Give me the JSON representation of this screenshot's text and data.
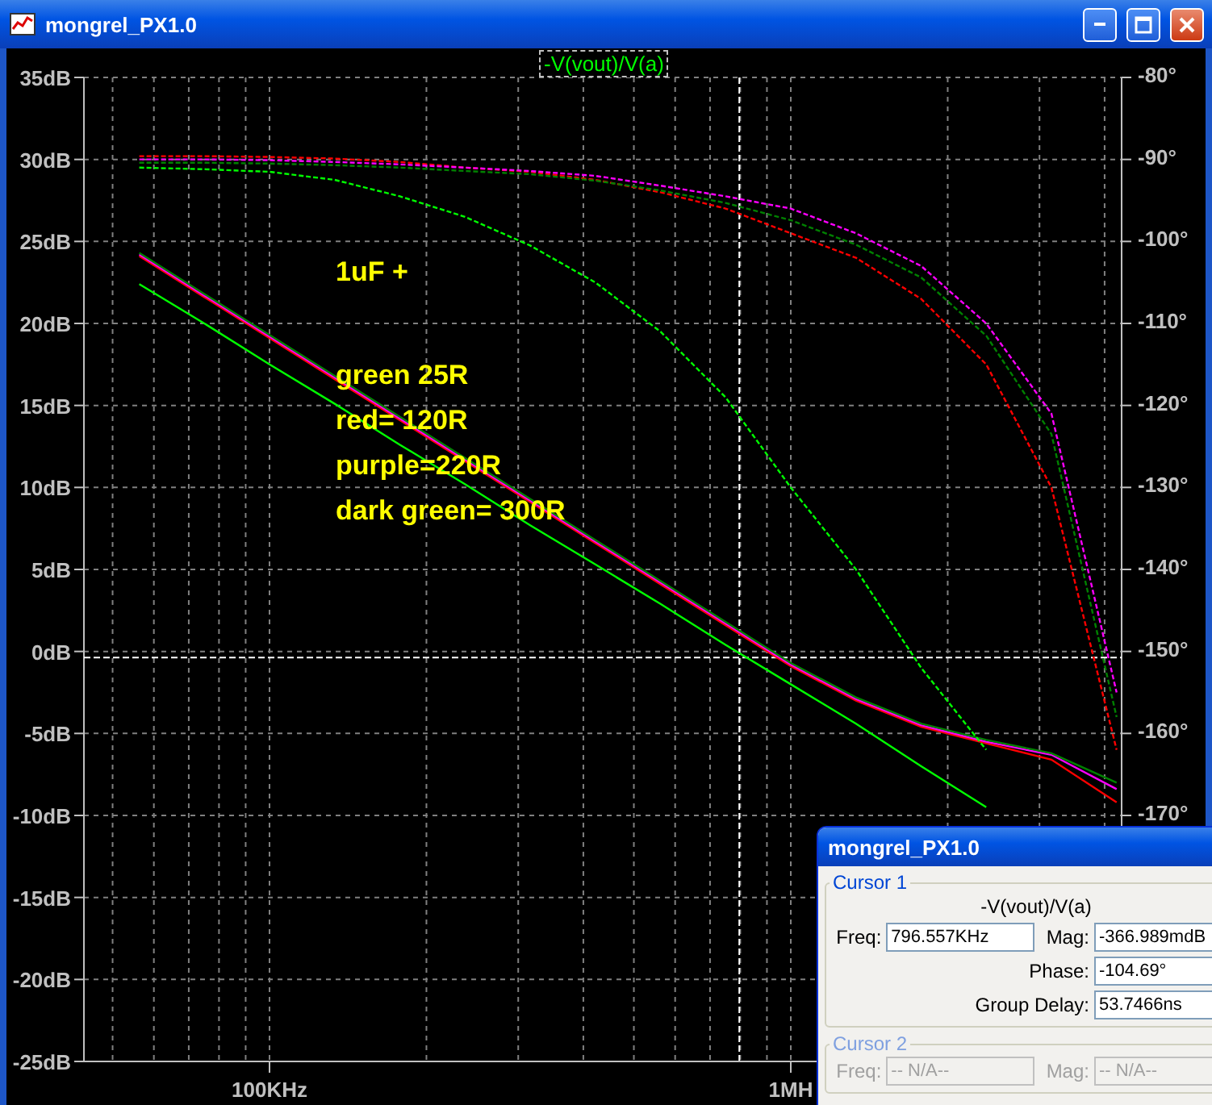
{
  "window": {
    "title": "mongrel_PX1.0"
  },
  "plot": {
    "chart_data": {
      "type": "line",
      "title": "-V(vout)/V(a)",
      "categories": [
        null,
        null,
        "100KHz",
        null,
        null,
        null,
        null,
        null,
        null,
        null,
        "1MH",
        null,
        null,
        null,
        null,
        null
      ],
      "ylim": [
        -25,
        35
      ],
      "y2lim": [
        -200,
        -80
      ],
      "grid": true,
      "yticks": [
        {
          "value": 35,
          "label": "35dB"
        },
        {
          "value": 30,
          "label": "30dB"
        },
        {
          "value": 25,
          "label": "25dB"
        },
        {
          "value": 20,
          "label": "20dB"
        },
        {
          "value": 15,
          "label": "15dB"
        },
        {
          "value": 10,
          "label": "10dB"
        },
        {
          "value": 5,
          "label": "5dB"
        },
        {
          "value": 0,
          "label": "0dB"
        },
        {
          "value": -5,
          "label": "-5dB"
        },
        {
          "value": -10,
          "label": "-10dB"
        },
        {
          "value": -15,
          "label": "-15dB"
        },
        {
          "value": -20,
          "label": "-20dB"
        },
        {
          "value": -25,
          "label": "-25dB"
        }
      ],
      "y2ticks": [
        {
          "value": -80,
          "label": "-80°"
        },
        {
          "value": -90,
          "label": "-90°"
        },
        {
          "value": -100,
          "label": "-100°"
        },
        {
          "value": -110,
          "label": "-110°"
        },
        {
          "value": -120,
          "label": "-120°"
        },
        {
          "value": -130,
          "label": "-130°"
        },
        {
          "value": -140,
          "label": "-140°"
        },
        {
          "value": -150,
          "label": "-150°"
        },
        {
          "value": -160,
          "label": "-160°"
        },
        {
          "value": -170,
          "label": "-170°"
        }
      ],
      "series": [
        {
          "color": "#00ff00",
          "values": [
            22.4,
            20.0,
            17.5,
            15.1,
            12.6,
            10.2,
            7.7,
            5.3,
            2.9,
            0.4,
            -2.0,
            -4.4,
            -7.0,
            -9.5,
            null,
            null
          ]
        },
        {
          "color": "#ff0000",
          "values": [
            24.1,
            21.6,
            19.1,
            16.6,
            14.1,
            11.6,
            9.1,
            6.6,
            4.1,
            1.6,
            -0.9,
            -3.0,
            -4.6,
            -5.6,
            -6.6,
            -9.2
          ]
        },
        {
          "color": "#ff00ff",
          "values": [
            24.2,
            21.7,
            19.2,
            16.7,
            14.2,
            11.7,
            9.2,
            6.7,
            4.2,
            1.7,
            -0.8,
            -2.9,
            -4.5,
            -5.5,
            -6.3,
            -8.4
          ]
        },
        {
          "color": "#008000",
          "values": [
            24.3,
            21.8,
            19.3,
            16.8,
            14.3,
            11.8,
            9.3,
            6.8,
            4.3,
            1.8,
            -0.7,
            -2.8,
            -4.4,
            -5.4,
            -6.2,
            -8.0
          ]
        },
        {
          "color": "#00ff00",
          "axis": "y2",
          "line_style": "dashed",
          "values": [
            -91.0,
            -91.2,
            -91.5,
            -92.5,
            -94.5,
            -97,
            -100.5,
            -105,
            -111,
            -119,
            -130,
            -140,
            -152,
            -162,
            null,
            null
          ]
        },
        {
          "color": "#ff0000",
          "axis": "y2",
          "line_style": "dashed",
          "values": [
            -89.6,
            -89.6,
            -89.7,
            -89.9,
            -90.3,
            -91,
            -91.5,
            -92.5,
            -94,
            -96,
            -99,
            -102,
            -107,
            -115,
            -130,
            -162
          ]
        },
        {
          "color": "#ff00ff",
          "axis": "y2",
          "line_style": "dashed",
          "values": [
            -90.0,
            -90.0,
            -90.1,
            -90.3,
            -90.6,
            -91.0,
            -91.4,
            -92,
            -93.2,
            -94.5,
            -96,
            -99,
            -103,
            -110,
            -121,
            -155
          ]
        },
        {
          "color": "#008000",
          "axis": "y2",
          "line_style": "dashed",
          "values": [
            -90.4,
            -90.4,
            -90.5,
            -90.7,
            -91.0,
            -91.4,
            -91.8,
            -92.6,
            -93.8,
            -95.3,
            -97.4,
            -100.4,
            -104.4,
            -111.5,
            -123.5,
            -158
          ]
        }
      ],
      "annotations": [
        "1uF +",
        "green 25R",
        "red= 120R",
        "purple=220R",
        "dark green= 300R"
      ],
      "ref_lines": [
        {
          "axis": "y",
          "value": -0.367
        }
      ]
    }
  },
  "cursor_dialog": {
    "title": "mongrel_PX1.0",
    "groups": [
      {
        "label": "Cursor 1",
        "disabled": false,
        "trace": "-V(vout)/V(a)",
        "fields": [
          {
            "label": "Freq:",
            "value": "796.557KHz"
          },
          {
            "label": "Mag:",
            "value": "-366.989mdB"
          },
          {
            "label": "Phase:",
            "value": "-104.69°"
          },
          {
            "label": "Group Delay:",
            "value": "53.7466ns"
          }
        ]
      },
      {
        "label": "Cursor 2",
        "disabled": true,
        "fields": [
          {
            "label": "Freq:",
            "value": "-- N/A--"
          },
          {
            "label": "Mag:",
            "value": "-- N/A--"
          }
        ]
      }
    ]
  }
}
